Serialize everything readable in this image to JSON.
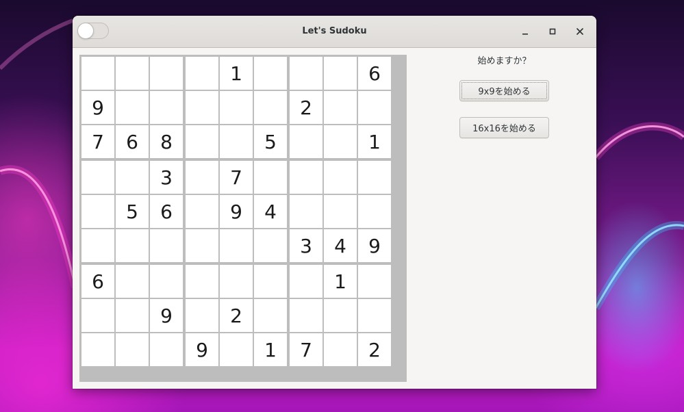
{
  "window": {
    "title": "Let's Sudoku"
  },
  "controls": {
    "minimize": "minimize-icon",
    "maximize": "maximize-icon",
    "close": "close-icon"
  },
  "toggle": {
    "state": "off"
  },
  "side": {
    "prompt": "始めますか？",
    "start9_label": "9x9を始める",
    "start16_label": "16x16を始める"
  },
  "board": {
    "size": 9,
    "rows": [
      [
        "",
        "",
        "",
        "",
        "1",
        "",
        "",
        "",
        "6"
      ],
      [
        "9",
        "",
        "",
        "",
        "",
        "",
        "2",
        "",
        ""
      ],
      [
        "7",
        "6",
        "8",
        "",
        "",
        "5",
        "",
        "",
        "1"
      ],
      [
        "",
        "",
        "3",
        "",
        "7",
        "",
        "",
        "",
        ""
      ],
      [
        "",
        "5",
        "6",
        "",
        "9",
        "4",
        "",
        "",
        ""
      ],
      [
        "",
        "",
        "",
        "",
        "",
        "",
        "3",
        "4",
        "9"
      ],
      [
        "6",
        "",
        "",
        "",
        "",
        "",
        "",
        "1",
        ""
      ],
      [
        "",
        "",
        "9",
        "",
        "2",
        "",
        "",
        "",
        ""
      ],
      [
        "",
        "",
        "",
        "9",
        "",
        "1",
        "7",
        "",
        "2"
      ]
    ]
  }
}
